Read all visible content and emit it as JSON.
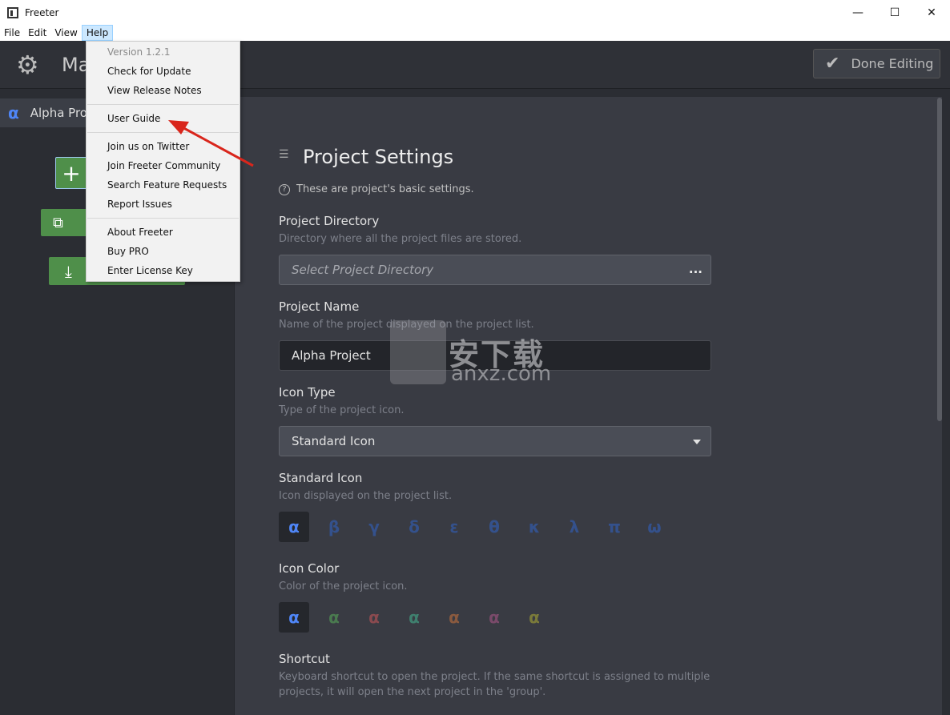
{
  "window": {
    "title": "Freeter",
    "controls": {
      "minimize": "—",
      "maximize": "☐",
      "close": "✕"
    }
  },
  "menubar": {
    "items": [
      {
        "label": "File"
      },
      {
        "label": "Edit"
      },
      {
        "label": "View"
      },
      {
        "label": "Help"
      }
    ]
  },
  "help_menu": {
    "version": "Version 1.2.1",
    "check_update": "Check for Update",
    "release_notes": "View Release Notes",
    "user_guide": "User Guide",
    "twitter": "Join us on Twitter",
    "community": "Join Freeter Community",
    "feature_requests": "Search Feature Requests",
    "report_issues": "Report Issues",
    "about": "About Freeter",
    "buy_pro": "Buy PRO",
    "license_key": "Enter License Key"
  },
  "header": {
    "title": "Ma",
    "done_button": "Done Editing"
  },
  "sidebar": {
    "project_icon": "α",
    "project_name": "Alpha Pro",
    "add_label": "+",
    "duplicate_label": "⧉",
    "import_label": "⤓"
  },
  "settings": {
    "title": "Project Settings",
    "hint": "These are project's basic settings.",
    "directory": {
      "label": "Project Directory",
      "desc": "Directory where all the project files are stored.",
      "placeholder": "Select Project Directory",
      "browse": "..."
    },
    "name": {
      "label": "Project Name",
      "desc": "Name of the project displayed on the project list.",
      "value": "Alpha Project"
    },
    "icon_type": {
      "label": "Icon Type",
      "desc": "Type of the project icon.",
      "value": "Standard Icon"
    },
    "standard_icon": {
      "label": "Standard Icon",
      "desc": "Icon displayed on the project list.",
      "icons": [
        "α",
        "β",
        "γ",
        "δ",
        "ε",
        "θ",
        "κ",
        "λ",
        "π",
        "ω"
      ]
    },
    "icon_color": {
      "label": "Icon Color",
      "desc": "Color of the project icon.",
      "glyph": "α",
      "colors": [
        "#4f86f7",
        "#4a7a4f",
        "#8a4a4f",
        "#3f7f6e",
        "#8a5a3f",
        "#7a4a6a",
        "#7a7a3a"
      ]
    },
    "shortcut": {
      "label": "Shortcut",
      "desc_line1": "Keyboard shortcut to open the project. If the same shortcut is assigned to multiple",
      "desc_line2": "projects, it will open the next project in the 'group'."
    }
  },
  "watermark": {
    "text": "安下载",
    "sub": "anxz.com"
  },
  "colors": {
    "accent_blue": "#4f86f7",
    "green_button": "#4f8f4a",
    "arrow_red": "#d9261c"
  }
}
